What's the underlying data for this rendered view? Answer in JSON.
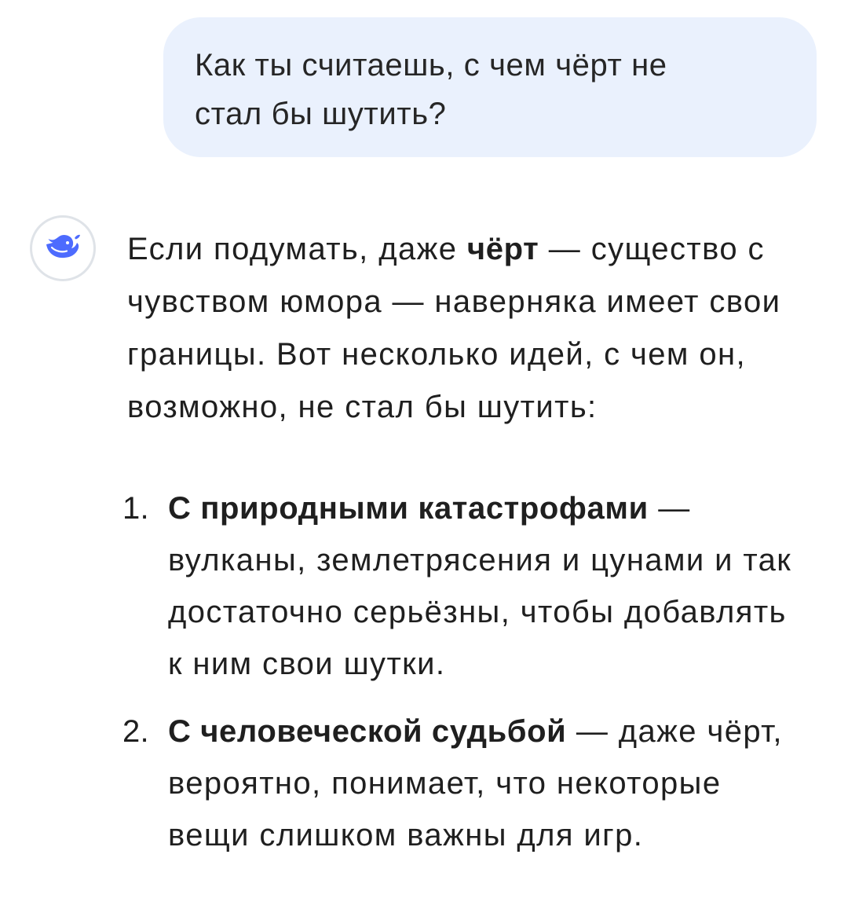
{
  "user_message": {
    "line1": "Как ты считаешь, с чем чёрт не",
    "line2": "стал бы шутить?"
  },
  "assistant": {
    "avatar_icon": "whale-logo-icon",
    "accent_color": "#4d6bfe",
    "intro": {
      "before_bold": "Если подумать, даже ",
      "bold": "чёрт",
      "after_bold": " — существо с чувством юмора — наверняка имеет свои границы. Вот несколько идей, с чем он, возможно, не стал бы шутить:"
    },
    "list": [
      {
        "number": "1.",
        "bold": "С природными катастрофами",
        "text": " — вулканы, землетрясения и цунами и так достаточно серьёзны, чтобы добавлять к ним свои шутки."
      },
      {
        "number": "2.",
        "bold": "С человеческой судьбой",
        "text": " — даже чёрт, вероятно, понимает, что некоторые вещи слишком важны для игр."
      }
    ]
  }
}
